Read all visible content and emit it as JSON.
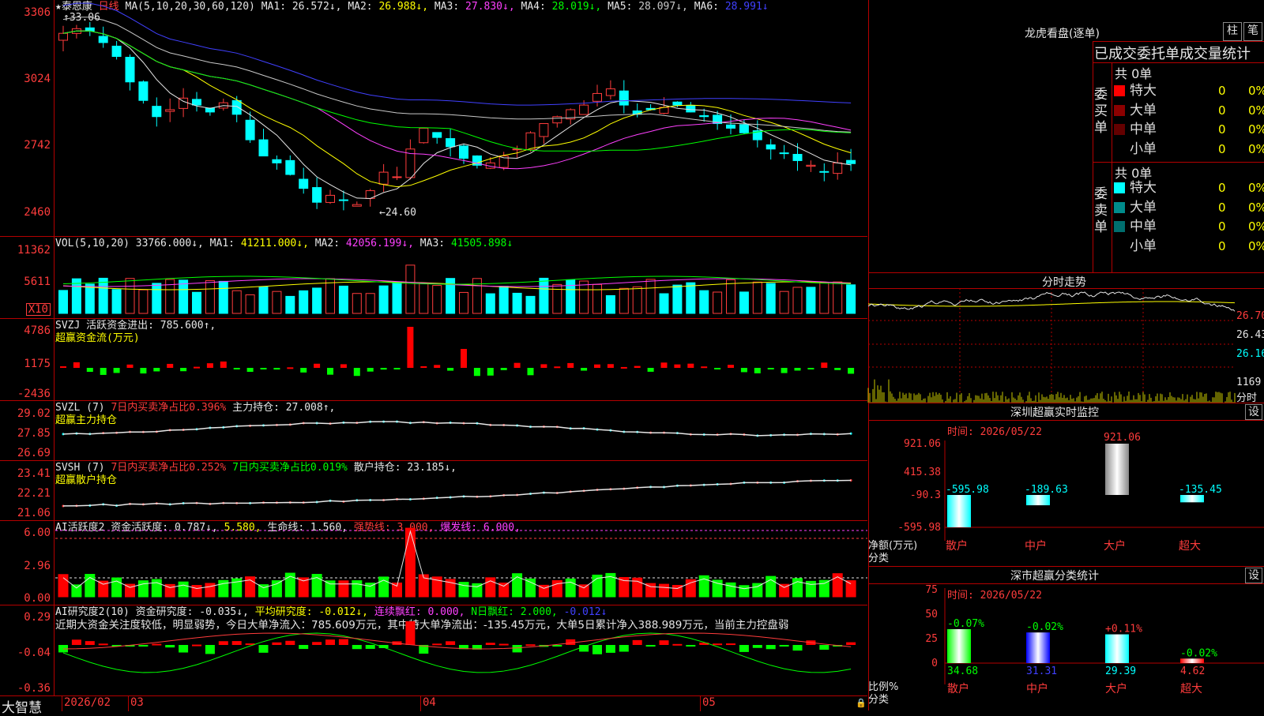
{
  "app": {
    "brand": "大智慧"
  },
  "kline": {
    "stock": "泰恩康",
    "period": "日线",
    "ma_label": "MA(5,10,20,30,60,120)",
    "ma": [
      {
        "name": "MA1",
        "value": "26.572↓",
        "color": "#e6e6e6"
      },
      {
        "name": "MA2",
        "value": "26.988↓",
        "color": "#ffff00"
      },
      {
        "name": "MA3",
        "value": "27.830↓",
        "color": "#ff40ff"
      },
      {
        "name": "MA4",
        "value": "28.019↓",
        "color": "#00ff00"
      },
      {
        "name": "MA5",
        "value": "28.097↓",
        "color": "#c8c8c8"
      },
      {
        "name": "MA6",
        "value": "28.991↓",
        "color": "#4040ff"
      }
    ],
    "y_labels": [
      "3306",
      "3024",
      "2742",
      "2460"
    ],
    "high_mark": "33.06",
    "low_mark": "←24.60"
  },
  "vol": {
    "label": "VOL(5,10,20)",
    "value": "33766.000↓,",
    "ma1": "41211.000↓,",
    "ma2": "42056.199↓,",
    "ma3": "41505.898↓",
    "y_labels": [
      "11362",
      "5611"
    ],
    "unit": "X10"
  },
  "svzj": {
    "line1": "SVZJ  活跃资金进出: 785.600↑,",
    "line2": "超赢资金流(万元)",
    "y_labels": [
      "4786",
      "1175",
      "-2436"
    ]
  },
  "svzl": {
    "name": "SVZL (7)",
    "t1": "7日内买卖净占比0.396%",
    "t2": "主力持仓: 27.008↑,",
    "line2": "超赢主力持仓",
    "y_labels": [
      "29.02",
      "27.85",
      "26.69"
    ]
  },
  "svsh": {
    "name": "SVSH (7)",
    "t1": "7日内买卖净占比0.252%",
    "t2": "7日内买卖净占比0.019%",
    "t3": "散户持仓: 23.185↓,",
    "line2": "超赢散户持仓",
    "y_labels": [
      "23.41",
      "22.21",
      "21.06"
    ]
  },
  "ai1": {
    "t1": "AI活跃度2 资金活跃度: 0.787↓,",
    "t2": "5.580,",
    "t3": "生命线: 1.560,",
    "t4": "强势线: 3.000,",
    "t5": "爆发线: 6.000,",
    "y_labels": [
      "6.00",
      "2.96",
      "0.00"
    ]
  },
  "ai2": {
    "t1": "AI研究度2(10) 资金研究度: -0.035↓,",
    "t2": "平均研究度: -0.012↓,",
    "t3": "连续飘红: 0.000,",
    "t4": "N日飘红: 2.000,",
    "t5": "-0.012↓",
    "comment": "近期大资金关注度较低，明显弱势，今日大单净流入：785.609万元，其中特大单净流出：-135.45万元，大单5日累计净入388.989万元，当前主力控盘弱",
    "y_labels": [
      "0.29",
      "-0.04",
      "-0.36"
    ]
  },
  "xaxis": {
    "labels": [
      "2026/02",
      "03",
      "04",
      "05"
    ]
  },
  "lhb": {
    "title": "龙虎看盘(逐单)",
    "btn1": "柱",
    "btn2": "笔",
    "subtitle": "已成交委托单成交量统计",
    "buy_side": "委买单",
    "sell_side": "委卖单",
    "buy_total": "共 0单",
    "sell_total": "共 0单",
    "buy_rows": [
      {
        "label": "特大",
        "color": "#ff0000",
        "v1": "0",
        "v2": "0%"
      },
      {
        "label": "大单",
        "color": "#8c0000",
        "v1": "0",
        "v2": "0%"
      },
      {
        "label": "中单",
        "color": "#640000",
        "v1": "0",
        "v2": "0%"
      },
      {
        "label": "小单",
        "color": "#000000",
        "v1": "0",
        "v2": "0%"
      }
    ],
    "sell_rows": [
      {
        "label": "特大",
        "color": "#00ffff",
        "v1": "0",
        "v2": "0%"
      },
      {
        "label": "大单",
        "color": "#008c8c",
        "v1": "0",
        "v2": "0%"
      },
      {
        "label": "中单",
        "color": "#006e6e",
        "v1": "0",
        "v2": "0%"
      },
      {
        "label": "小单",
        "color": "#000000",
        "v1": "0",
        "v2": "0%"
      }
    ]
  },
  "intraday": {
    "title": "分时走势",
    "y_labels": [
      "26.70",
      "26.43",
      "26.16"
    ],
    "vol_label": "1169",
    "unit": "分时"
  },
  "sz_monitor": {
    "title": "深圳超赢实时监控",
    "btn": "设",
    "time": "时间: 2026/05/22",
    "y_labels": [
      "921.06",
      "415.38",
      "-90.3",
      "-595.98"
    ],
    "ylabel": "净额(万元)",
    "xlabel": "分类",
    "categories": [
      "散户",
      "中户",
      "大户",
      "超大"
    ],
    "values": [
      -595.98,
      -189.63,
      921.06,
      -135.45
    ],
    "value_labels": [
      "-595.98",
      "-189.63",
      "921.06",
      "-135.45"
    ]
  },
  "sz_class": {
    "title": "深市超赢分类统计",
    "btn": "设",
    "time": "时间: 2026/05/22",
    "y_labels": [
      "75",
      "50",
      "25",
      "0"
    ],
    "ylabel": "比例%",
    "xlabel": "分类",
    "categories": [
      "散户",
      "中户",
      "大户",
      "超大"
    ],
    "values": [
      34.68,
      31.31,
      29.39,
      4.62
    ],
    "changes": [
      "-0.07%",
      "-0.02%",
      "+0.11%",
      "-0.02%"
    ]
  }
}
